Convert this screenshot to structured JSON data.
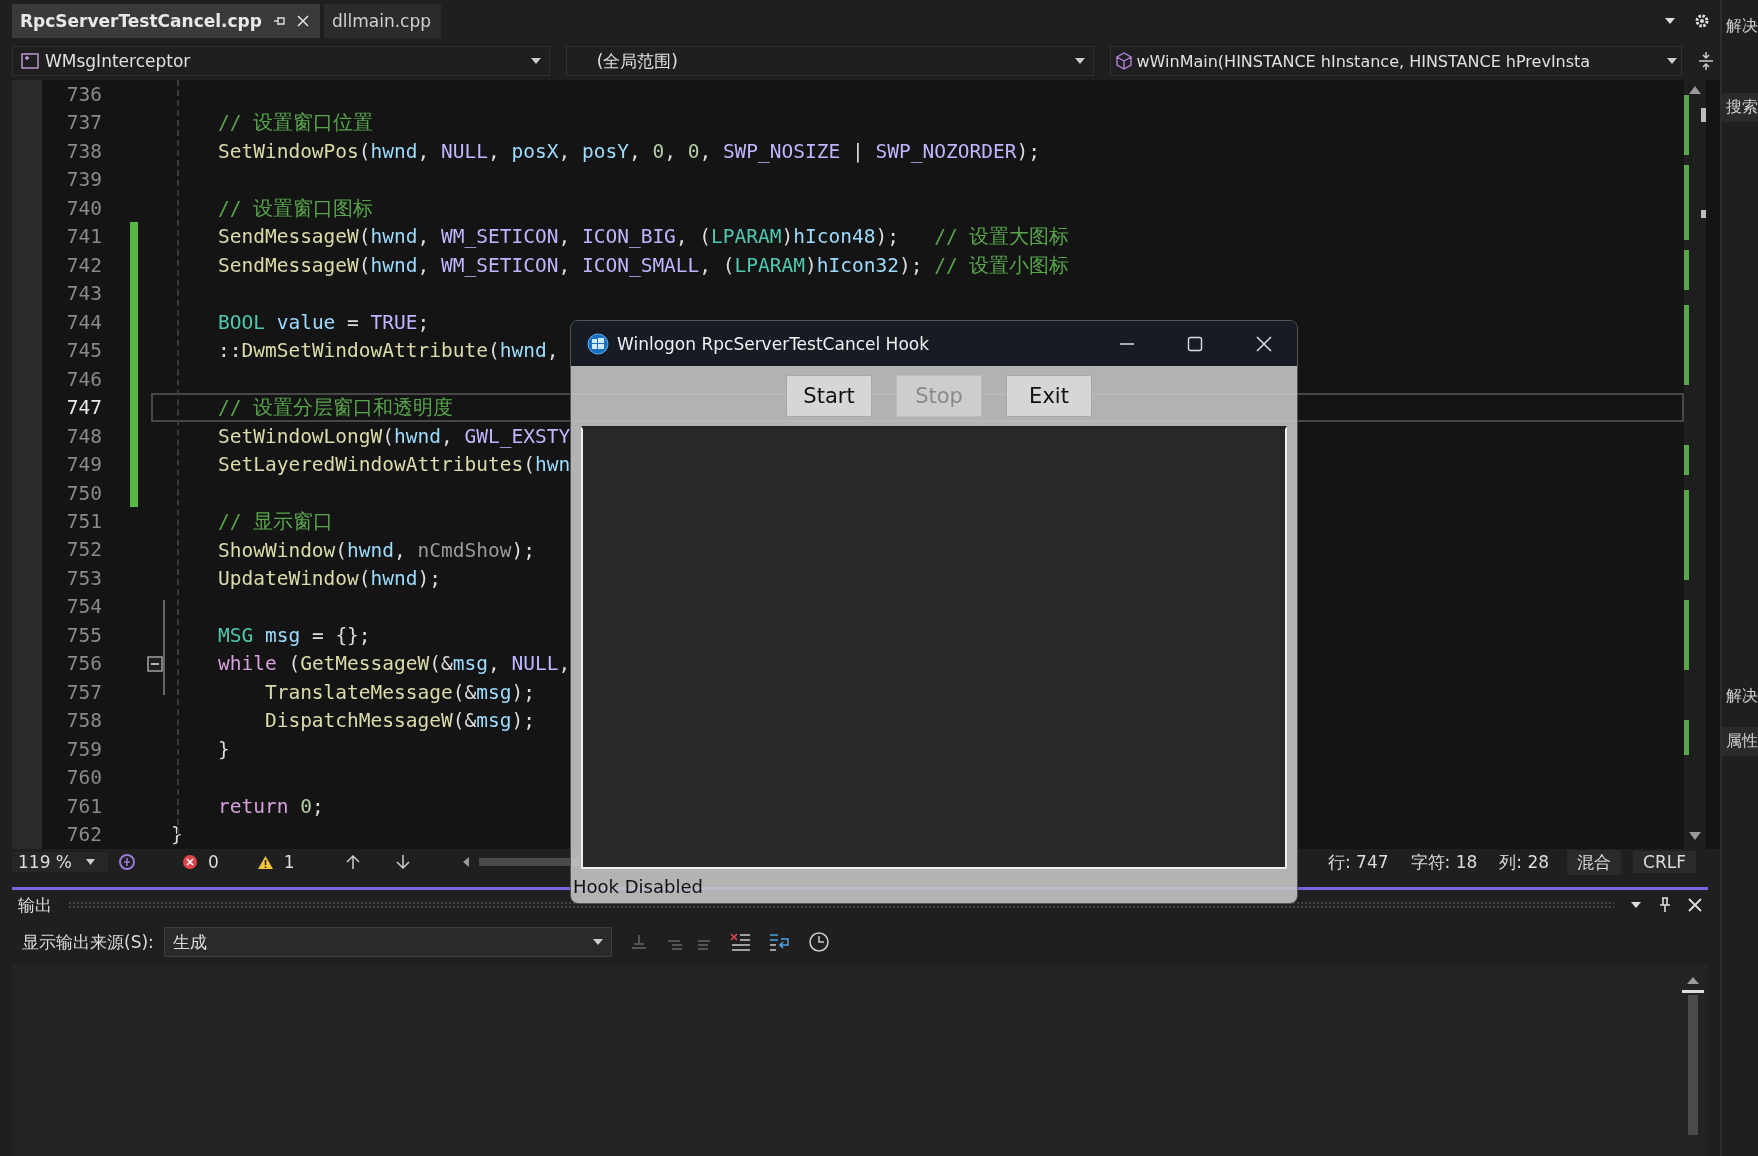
{
  "tabs": [
    {
      "label": "RpcServerTestCancel.cpp",
      "selected": true
    },
    {
      "label": "dllmain.cpp",
      "selected": false
    }
  ],
  "nav": {
    "project": "WMsgInterceptor",
    "scope": "(全局范围)",
    "member": "wWinMain(HINSTANCE hInstance, HINSTANCE hPrevInsta"
  },
  "editor": {
    "lines": [
      {
        "number": "736",
        "current": false,
        "changed": false,
        "fold": false
      },
      {
        "number": "737",
        "current": false,
        "changed": false,
        "fold": false,
        "kind": "body",
        "tokens": [
          {
            "kind": "cm",
            "text": "// 设置窗口位置"
          }
        ]
      },
      {
        "number": "738",
        "current": false,
        "changed": false,
        "fold": false,
        "kind": "body",
        "tokens": [
          {
            "kind": "fn",
            "text": "SetWindowPos"
          },
          {
            "kind": "p",
            "text": "("
          },
          {
            "kind": "var",
            "text": "hwnd"
          },
          {
            "kind": "p",
            "text": ", "
          },
          {
            "kind": "mac",
            "text": "NULL"
          },
          {
            "kind": "p",
            "text": ", "
          },
          {
            "kind": "var",
            "text": "posX"
          },
          {
            "kind": "p",
            "text": ", "
          },
          {
            "kind": "var",
            "text": "posY"
          },
          {
            "kind": "p",
            "text": ", "
          },
          {
            "kind": "num",
            "text": "0"
          },
          {
            "kind": "p",
            "text": ", "
          },
          {
            "kind": "num",
            "text": "0"
          },
          {
            "kind": "p",
            "text": ", "
          },
          {
            "kind": "mac",
            "text": "SWP_NOSIZE"
          },
          {
            "kind": "p",
            "text": " | "
          },
          {
            "kind": "mac",
            "text": "SWP_NOZORDER"
          },
          {
            "kind": "p",
            "text": ");"
          }
        ]
      },
      {
        "number": "739",
        "current": false,
        "changed": false,
        "fold": false
      },
      {
        "number": "740",
        "current": false,
        "changed": false,
        "fold": false,
        "kind": "body",
        "tokens": [
          {
            "kind": "cm",
            "text": "// 设置窗口图标"
          }
        ]
      },
      {
        "number": "741",
        "current": false,
        "changed": true,
        "fold": false,
        "kind": "body",
        "tokens": [
          {
            "kind": "fn",
            "text": "SendMessageW"
          },
          {
            "kind": "p",
            "text": "("
          },
          {
            "kind": "var",
            "text": "hwnd"
          },
          {
            "kind": "p",
            "text": ", "
          },
          {
            "kind": "mac",
            "text": "WM_SETICON"
          },
          {
            "kind": "p",
            "text": ", "
          },
          {
            "kind": "mac",
            "text": "ICON_BIG"
          },
          {
            "kind": "p",
            "text": ", ("
          },
          {
            "kind": "type",
            "text": "LPARAM"
          },
          {
            "kind": "p",
            "text": ")"
          },
          {
            "kind": "var",
            "text": "hIcon48"
          },
          {
            "kind": "p",
            "text": ");   "
          },
          {
            "kind": "cm",
            "text": "// 设置大图标"
          }
        ]
      },
      {
        "number": "742",
        "current": false,
        "changed": true,
        "fold": false,
        "kind": "body",
        "tokens": [
          {
            "kind": "fn",
            "text": "SendMessageW"
          },
          {
            "kind": "p",
            "text": "("
          },
          {
            "kind": "var",
            "text": "hwnd"
          },
          {
            "kind": "p",
            "text": ", "
          },
          {
            "kind": "mac",
            "text": "WM_SETICON"
          },
          {
            "kind": "p",
            "text": ", "
          },
          {
            "kind": "mac",
            "text": "ICON_SMALL"
          },
          {
            "kind": "p",
            "text": ", ("
          },
          {
            "kind": "type",
            "text": "LPARAM"
          },
          {
            "kind": "p",
            "text": ")"
          },
          {
            "kind": "var",
            "text": "hIcon32"
          },
          {
            "kind": "p",
            "text": "); "
          },
          {
            "kind": "cm",
            "text": "// 设置小图标"
          }
        ]
      },
      {
        "number": "743",
        "current": false,
        "changed": true,
        "fold": false
      },
      {
        "number": "744",
        "current": false,
        "changed": true,
        "fold": false,
        "kind": "body",
        "tokens": [
          {
            "kind": "type",
            "text": "BOOL"
          },
          {
            "kind": "var",
            "text": " value"
          },
          {
            "kind": "p",
            "text": " = "
          },
          {
            "kind": "mac",
            "text": "TRUE"
          },
          {
            "kind": "p",
            "text": ";"
          }
        ]
      },
      {
        "number": "745",
        "current": false,
        "changed": true,
        "fold": false,
        "kind": "body",
        "tokens": [
          {
            "kind": "p",
            "text": "::"
          },
          {
            "kind": "fn",
            "text": "DwmSetWindowAttribute"
          },
          {
            "kind": "p",
            "text": "("
          },
          {
            "kind": "var",
            "text": "hwnd"
          },
          {
            "kind": "p",
            "text": ","
          }
        ]
      },
      {
        "number": "746",
        "current": false,
        "changed": true,
        "fold": false
      },
      {
        "number": "747",
        "current": true,
        "changed": true,
        "fold": false,
        "kind": "body",
        "tokens": [
          {
            "kind": "cm",
            "text": "// 设置分层窗口和透明度"
          }
        ]
      },
      {
        "number": "748",
        "current": false,
        "changed": true,
        "fold": false,
        "kind": "body",
        "tokens": [
          {
            "kind": "fn",
            "text": "SetWindowLongW"
          },
          {
            "kind": "p",
            "text": "("
          },
          {
            "kind": "var",
            "text": "hwnd"
          },
          {
            "kind": "p",
            "text": ", "
          },
          {
            "kind": "mac",
            "text": "GWL_EXSTY"
          }
        ]
      },
      {
        "number": "749",
        "current": false,
        "changed": true,
        "fold": false,
        "kind": "body",
        "tokens": [
          {
            "kind": "fn",
            "text": "SetLayeredWindowAttributes"
          },
          {
            "kind": "p",
            "text": "("
          },
          {
            "kind": "var",
            "text": "hwn"
          }
        ]
      },
      {
        "number": "750",
        "current": false,
        "changed": true,
        "fold": false
      },
      {
        "number": "751",
        "current": false,
        "changed": false,
        "fold": false,
        "kind": "body",
        "tokens": [
          {
            "kind": "cm",
            "text": "// 显示窗口"
          }
        ]
      },
      {
        "number": "752",
        "current": false,
        "changed": false,
        "fold": false,
        "kind": "body",
        "tokens": [
          {
            "kind": "fn",
            "text": "ShowWindow"
          },
          {
            "kind": "p",
            "text": "("
          },
          {
            "kind": "var",
            "text": "hwnd"
          },
          {
            "kind": "p",
            "text": ", "
          },
          {
            "kind": "param",
            "text": "nCmdShow"
          },
          {
            "kind": "p",
            "text": ");"
          }
        ]
      },
      {
        "number": "753",
        "current": false,
        "changed": false,
        "fold": false,
        "kind": "body",
        "tokens": [
          {
            "kind": "fn",
            "text": "UpdateWindow"
          },
          {
            "kind": "p",
            "text": "("
          },
          {
            "kind": "var",
            "text": "hwnd"
          },
          {
            "kind": "p",
            "text": ");"
          }
        ]
      },
      {
        "number": "754",
        "current": false,
        "changed": false,
        "fold": false
      },
      {
        "number": "755",
        "current": false,
        "changed": false,
        "fold": false,
        "kind": "body",
        "tokens": [
          {
            "kind": "type",
            "text": "MSG"
          },
          {
            "kind": "var",
            "text": " msg"
          },
          {
            "kind": "p",
            "text": " = {};"
          }
        ]
      },
      {
        "number": "756",
        "current": false,
        "changed": false,
        "fold": true,
        "kind": "body",
        "tokens": [
          {
            "kind": "ctl",
            "text": "while"
          },
          {
            "kind": "p",
            "text": " ("
          },
          {
            "kind": "fn",
            "text": "GetMessageW"
          },
          {
            "kind": "p",
            "text": "(&"
          },
          {
            "kind": "var",
            "text": "msg"
          },
          {
            "kind": "p",
            "text": ", "
          },
          {
            "kind": "mac",
            "text": "NULL"
          },
          {
            "kind": "p",
            "text": ","
          }
        ]
      },
      {
        "number": "757",
        "current": false,
        "changed": false,
        "fold": false,
        "kind": "inner",
        "tokens": [
          {
            "kind": "fn",
            "text": "TranslateMessage"
          },
          {
            "kind": "p",
            "text": "(&"
          },
          {
            "kind": "var",
            "text": "msg"
          },
          {
            "kind": "p",
            "text": ");"
          }
        ]
      },
      {
        "number": "758",
        "current": false,
        "changed": false,
        "fold": false,
        "kind": "inner",
        "tokens": [
          {
            "kind": "fn",
            "text": "DispatchMessageW"
          },
          {
            "kind": "p",
            "text": "(&"
          },
          {
            "kind": "var",
            "text": "msg"
          },
          {
            "kind": "p",
            "text": ");"
          }
        ]
      },
      {
        "number": "759",
        "current": false,
        "changed": false,
        "fold": false,
        "kind": "body",
        "tokens": [
          {
            "kind": "p",
            "text": "}"
          }
        ]
      },
      {
        "number": "760",
        "current": false,
        "changed": false,
        "fold": false
      },
      {
        "number": "761",
        "current": false,
        "changed": false,
        "fold": false,
        "kind": "body",
        "tokens": [
          {
            "kind": "ctl",
            "text": "return"
          },
          {
            "kind": "num",
            "text": " 0"
          },
          {
            "kind": "p",
            "text": ";"
          }
        ]
      },
      {
        "number": "762",
        "current": false,
        "changed": false,
        "fold": false,
        "kind": "top",
        "tokens": [
          {
            "kind": "p",
            "text": "}"
          }
        ]
      }
    ]
  },
  "status_bar": {
    "zoom": "119 %",
    "errors": "0",
    "warnings": "1",
    "line": "行: 747",
    "char": "字符: 18",
    "col": "列: 28",
    "encoding": "混合",
    "eol": "CRLF"
  },
  "output": {
    "title": "输出",
    "source_label": "显示输出来源(S):",
    "source": "生成"
  },
  "side_panel": [
    "解决",
    "搜索",
    "解决",
    "属性"
  ],
  "dialog": {
    "title": "Winlogon RpcServerTestCancel Hook",
    "buttons": [
      {
        "label": "Start",
        "disabled": false
      },
      {
        "label": "Stop",
        "disabled": true
      },
      {
        "label": "Exit",
        "disabled": false
      }
    ],
    "status": "Hook Disabled"
  }
}
